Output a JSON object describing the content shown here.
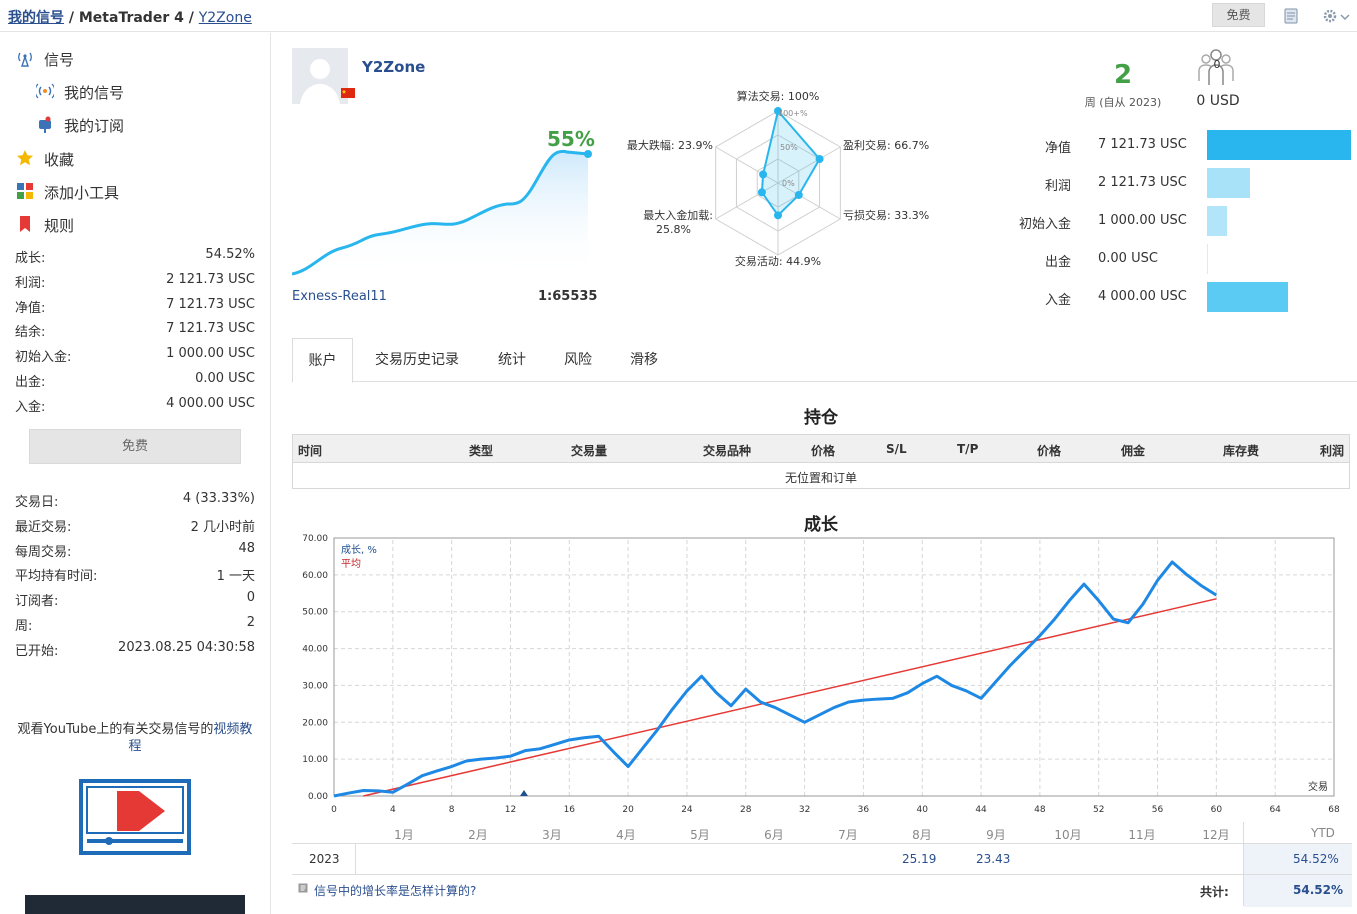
{
  "breadcrumb": {
    "part1": "我的信号",
    "sep1": " / ",
    "part2": "MetaTrader 4",
    "sep2": " / ",
    "part3": "Y2Zone"
  },
  "topbar": {
    "free_label": "免费"
  },
  "sidebar": {
    "nav": [
      {
        "label": "信号"
      },
      {
        "label": "我的信号"
      },
      {
        "label": "我的订阅"
      },
      {
        "label": "收藏"
      },
      {
        "label": "添加小工具"
      },
      {
        "label": "规则"
      }
    ],
    "stats": [
      {
        "k": "成长:",
        "v": "54.52%"
      },
      {
        "k": "利润:",
        "v": "2 121.73 USC"
      },
      {
        "k": "净值:",
        "v": "7 121.73 USC"
      },
      {
        "k": "结余:",
        "v": "7 121.73 USC"
      },
      {
        "k": "初始入金:",
        "v": "1 000.00 USC"
      },
      {
        "k": "出金:",
        "v": "0.00 USC"
      },
      {
        "k": "入金:",
        "v": "4 000.00 USC"
      }
    ],
    "free_button": "免费",
    "stats2": [
      {
        "k": "交易日:",
        "v": "4 (33.33%)"
      },
      {
        "k": "最近交易:",
        "v": "2 几小时前"
      },
      {
        "k": "每周交易:",
        "v": "48"
      },
      {
        "k": "平均持有时间:",
        "v": "1 一天"
      },
      {
        "k": "订阅者:",
        "v": "0"
      },
      {
        "k": "周:",
        "v": "2"
      },
      {
        "k": "已开始:",
        "v": "2023.08.25 04:30:58"
      }
    ],
    "youtube_text": "观看YouTube上的有关交易信号的",
    "youtube_link": "视频教程"
  },
  "profile": {
    "name": "Y2Zone",
    "growth_pct": "55%",
    "broker": "Exness-Real11",
    "leverage": "1:65535"
  },
  "radar": {
    "labels": {
      "algo": "算法交易: 100%",
      "profit_trades": "盈利交易: 66.7%",
      "loss_trades": "亏损交易: 33.3%",
      "activity": "交易活动: 44.9%",
      "max_deposit_load_1": "最大入金加载:",
      "max_deposit_load_2": "25.8%",
      "max_drawdown": "最大跌幅: 23.9%"
    },
    "rings": {
      "r100": "100+%",
      "r50": "50%",
      "r0": "0%"
    },
    "values": [
      100,
      66.7,
      33.3,
      44.9,
      25.8,
      23.9
    ]
  },
  "weeks": {
    "value": "2",
    "label": "周 (自从 2023)"
  },
  "subscribers": {
    "count": "0",
    "amount": "0 USD"
  },
  "balance_bars": [
    {
      "label": "净值",
      "value": "7 121.73 USC",
      "amount": 7121.73
    },
    {
      "label": "利润",
      "value": "2 121.73 USC",
      "amount": 2121.73
    },
    {
      "label": "初始入金",
      "value": "1 000.00 USC",
      "amount": 1000
    },
    {
      "label": "出金",
      "value": "0.00 USC",
      "amount": 0
    },
    {
      "label": "入金",
      "value": "4 000.00 USC",
      "amount": 4000
    }
  ],
  "tabs": [
    {
      "label": "账户"
    },
    {
      "label": "交易历史记录"
    },
    {
      "label": "统计"
    },
    {
      "label": "风险"
    },
    {
      "label": "滑移"
    }
  ],
  "positions": {
    "title": "持仓",
    "columns": [
      "时间",
      "类型",
      "交易量",
      "交易品种",
      "价格",
      "S/L",
      "T/P",
      "价格",
      "佣金",
      "库存费",
      "利润"
    ],
    "empty": "无位置和订单"
  },
  "growth": {
    "title": "成长",
    "legend_growth": "成长, %",
    "legend_avg": "平均",
    "x_axis_label": "交易",
    "months": [
      "1月",
      "2月",
      "3月",
      "4月",
      "5月",
      "6月",
      "7月",
      "8月",
      "9月",
      "10月",
      "11月",
      "12月"
    ],
    "ytd_label": "YTD",
    "year": "2023",
    "aug_value": "25.19",
    "sep_value": "23.43",
    "ytd_value": "54.52%",
    "faq": "信号中的增长率是怎样计算的?",
    "total_label": "共计:",
    "total_value": "54.52%"
  },
  "chart_data": [
    {
      "type": "line",
      "title": "成长",
      "xlabel": "交易",
      "ylabel": "",
      "xlim": [
        0,
        68
      ],
      "ylim": [
        0,
        70
      ],
      "x_ticks": [
        0,
        4,
        8,
        12,
        16,
        20,
        24,
        28,
        32,
        36,
        40,
        44,
        48,
        52,
        56,
        60,
        64,
        68
      ],
      "y_ticks": [
        0,
        10,
        20,
        30,
        40,
        50,
        60,
        70
      ],
      "grid": true,
      "legend": "top-left",
      "series": [
        {
          "name": "成长, %",
          "color": "#1e88e5",
          "x": [
            0,
            1,
            2,
            3,
            4,
            5,
            6,
            7,
            8,
            9,
            10,
            11,
            12,
            13,
            14,
            15,
            16,
            17,
            18,
            19,
            20,
            21,
            22,
            23,
            24,
            25,
            26,
            27,
            28,
            29,
            30,
            31,
            32,
            33,
            34,
            35,
            36,
            37,
            38,
            39,
            40,
            41,
            42,
            43,
            44,
            45,
            46,
            47,
            48,
            49,
            50,
            51,
            52,
            53,
            54,
            55,
            56,
            57,
            58,
            59,
            60
          ],
          "y": [
            0,
            0.8,
            1.5,
            1.4,
            1.0,
            3.2,
            5.5,
            6.8,
            8.0,
            9.5,
            10.0,
            10.3,
            10.8,
            12.3,
            12.8,
            14.0,
            15.2,
            15.8,
            16.2,
            12.0,
            8.0,
            13.0,
            18.0,
            23.5,
            28.5,
            32.5,
            28.0,
            24.5,
            29.0,
            25.5,
            24.0,
            22.0,
            20.0,
            22.0,
            24.0,
            25.5,
            26.0,
            26.3,
            26.5,
            28.0,
            30.5,
            32.5,
            30.0,
            28.5,
            26.5,
            31.0,
            35.5,
            39.5,
            43.5,
            48.0,
            53.0,
            57.5,
            53.0,
            48.0,
            47.0,
            52.0,
            58.5,
            63.5,
            60.0,
            57.0,
            54.5
          ]
        },
        {
          "name": "平均",
          "color": "#e53935",
          "x": [
            2,
            60
          ],
          "y": [
            0,
            53.5
          ]
        }
      ]
    }
  ]
}
